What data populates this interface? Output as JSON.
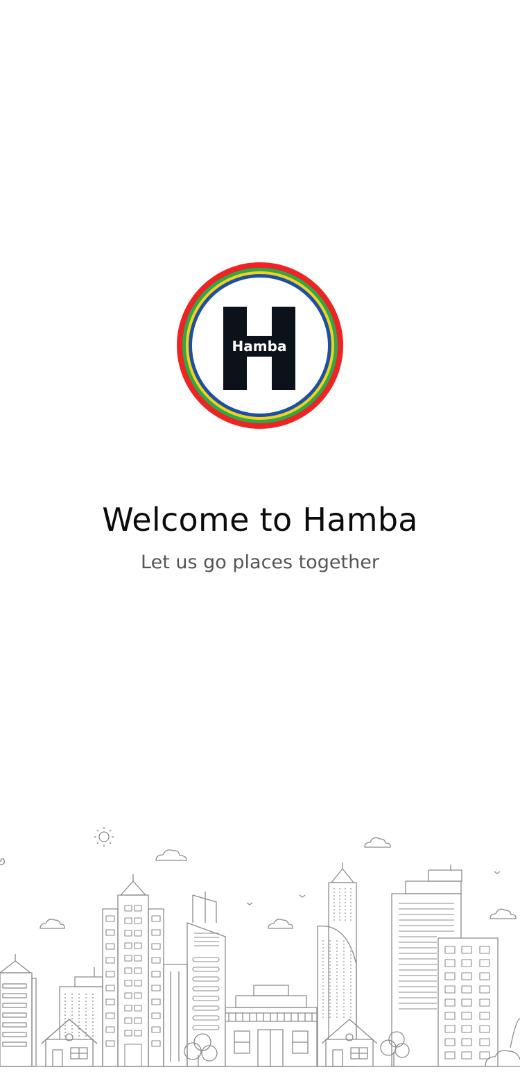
{
  "logo": {
    "text": "Hamba",
    "letter": "H",
    "ring_colors": [
      "#ee2424",
      "#2ea84a",
      "#f4d21c",
      "#1d4fa3"
    ],
    "letter_color": "#0c121a"
  },
  "welcome": {
    "title": "Welcome to Hamba",
    "subtitle": "Let us go places together"
  },
  "illustration": {
    "name": "city-skyline-line-art",
    "stroke_color": "#8a8a8a"
  }
}
